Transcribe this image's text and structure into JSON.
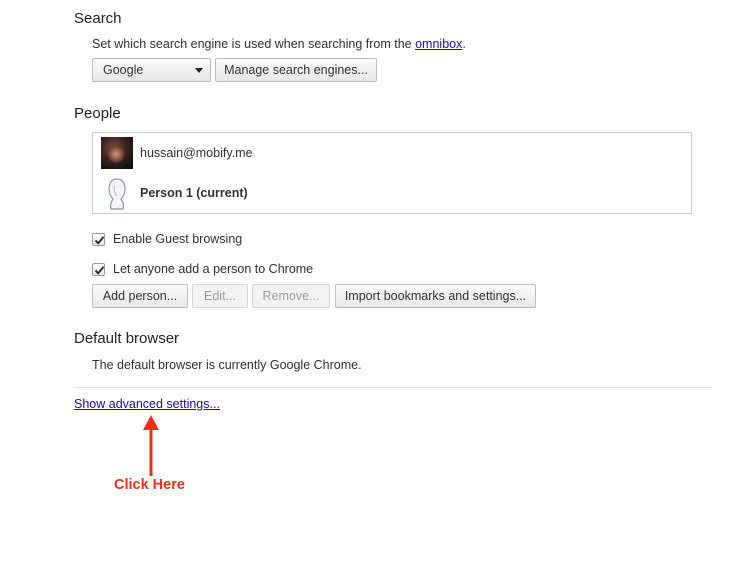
{
  "search": {
    "title": "Search",
    "description_prefix": "Set which search engine is used when searching from the ",
    "omnibox_link": "omnibox",
    "description_suffix": ".",
    "engine_selected": "Google",
    "manage_button": "Manage search engines..."
  },
  "people": {
    "title": "People",
    "profiles": [
      {
        "name": "hussain@mobify.me",
        "avatar": "photo-avatar"
      },
      {
        "name": "Person 1 (current)",
        "avatar": "generic-person-avatar"
      }
    ],
    "checkboxes": [
      {
        "label": "Enable Guest browsing",
        "checked": true
      },
      {
        "label": "Let anyone add a person to Chrome",
        "checked": true
      }
    ],
    "buttons": {
      "add": "Add person...",
      "edit": "Edit...",
      "remove": "Remove...",
      "import": "Import bookmarks and settings..."
    }
  },
  "default_browser": {
    "title": "Default browser",
    "description": "The default browser is currently Google Chrome."
  },
  "advanced_link": "Show advanced settings...",
  "annotation": {
    "text": "Click Here",
    "color": "#e3341a"
  }
}
